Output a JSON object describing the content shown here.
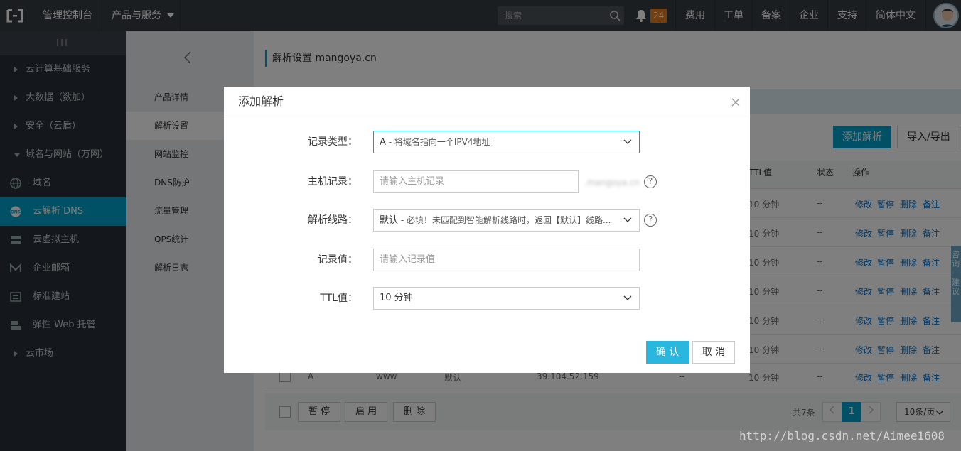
{
  "topbar": {
    "console": "管理控制台",
    "products": "产品与服务",
    "search_placeholder": "搜索",
    "notification_count": "24",
    "links": [
      "费用",
      "工单",
      "备案",
      "企业",
      "支持",
      "简体中文"
    ]
  },
  "sidebar": {
    "groups": [
      {
        "label": "云计算基础服务"
      },
      {
        "label": "大数据（数加）"
      },
      {
        "label": "安全（云盾）"
      },
      {
        "label": "域名与网站（万网）"
      }
    ],
    "items": [
      {
        "label": "域名",
        "icon": "globe-icon"
      },
      {
        "label": "云解析 DNS",
        "icon": "dns-icon"
      },
      {
        "label": "云虚拟主机",
        "icon": "server-icon"
      },
      {
        "label": "企业邮箱",
        "icon": "mail-icon"
      },
      {
        "label": "标准建站",
        "icon": "site-icon"
      },
      {
        "label": "弹性 Web 托管",
        "icon": "hosting-icon"
      }
    ],
    "market": "云市场"
  },
  "subnav": {
    "items": [
      "产品详情",
      "解析设置",
      "网站监控",
      "DNS防护",
      "流量管理",
      "QPS统计",
      "解析日志"
    ]
  },
  "main": {
    "title": "解析设置 mangoya.cn",
    "add_btn": "添加解析",
    "import_btn": "导入/导出",
    "columns": {
      "ttl": "TTL值",
      "status": "状态",
      "ops": "操作"
    },
    "row_ttl": "10 分钟",
    "row_status": "--",
    "ops": [
      "修改",
      "暂停",
      "删除",
      "备注"
    ],
    "last_row": {
      "type": "A",
      "host": "www",
      "line": "默认",
      "value": "39.104.52.159",
      "mx": "--",
      "ttl": "10 分钟"
    },
    "footer": {
      "pause": "暂 停",
      "enable": "启 用",
      "delete": "删 除",
      "total": "共7条",
      "page": "1",
      "page_size": "10条/页"
    }
  },
  "float_tab": "咨询·建议",
  "modal": {
    "title": "添加解析",
    "record_type_label": "记录类型：",
    "record_type_value": "A",
    "record_type_desc": " - 将域名指向一个IPV4地址",
    "host_label": "主机记录：",
    "host_placeholder": "请输入主机记录",
    "host_suffix": ".mangoya.cn",
    "line_label": "解析线路：",
    "line_value": "默认",
    "line_desc": " - 必填！未匹配到智能解析线路时，返回【默认】线路...",
    "value_label": "记录值：",
    "value_placeholder": "请输入记录值",
    "ttl_label": "TTL值：",
    "ttl_value": "10 分钟",
    "ok": "确 认",
    "cancel": "取 消"
  },
  "watermark": "http://blog.csdn.net/Aimee1608"
}
